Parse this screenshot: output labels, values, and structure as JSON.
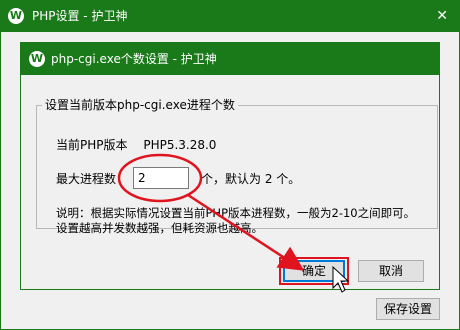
{
  "outer_window": {
    "title": "PHP设置 - 护卫神",
    "close_symbol": "✕",
    "logo_letter": "W",
    "save_button_label": "保存设置"
  },
  "dialog": {
    "title": "php-cgi.exe个数设置 - 护卫神",
    "logo_letter": "W",
    "group_title": "设置当前版本php-cgi.exe进程个数",
    "current_version_label": "当前PHP版本",
    "current_version_value": "PHP5.3.28.0",
    "max_process_label": "最大进程数",
    "max_process_value": "2",
    "max_process_suffix": "个，默认为 2 个。",
    "note_line1": "说明：根据实际情况设置当前PHP版本进程数，一般为2-10之间即可。",
    "note_line2": "设置越高并发数越强，但耗资源也越高。",
    "confirm_button_label": "确定",
    "cancel_button_label": "取消"
  },
  "colors": {
    "title_bar": "#1a7a1a",
    "annotation": "#e0141e",
    "focus_border": "#0078d7"
  }
}
